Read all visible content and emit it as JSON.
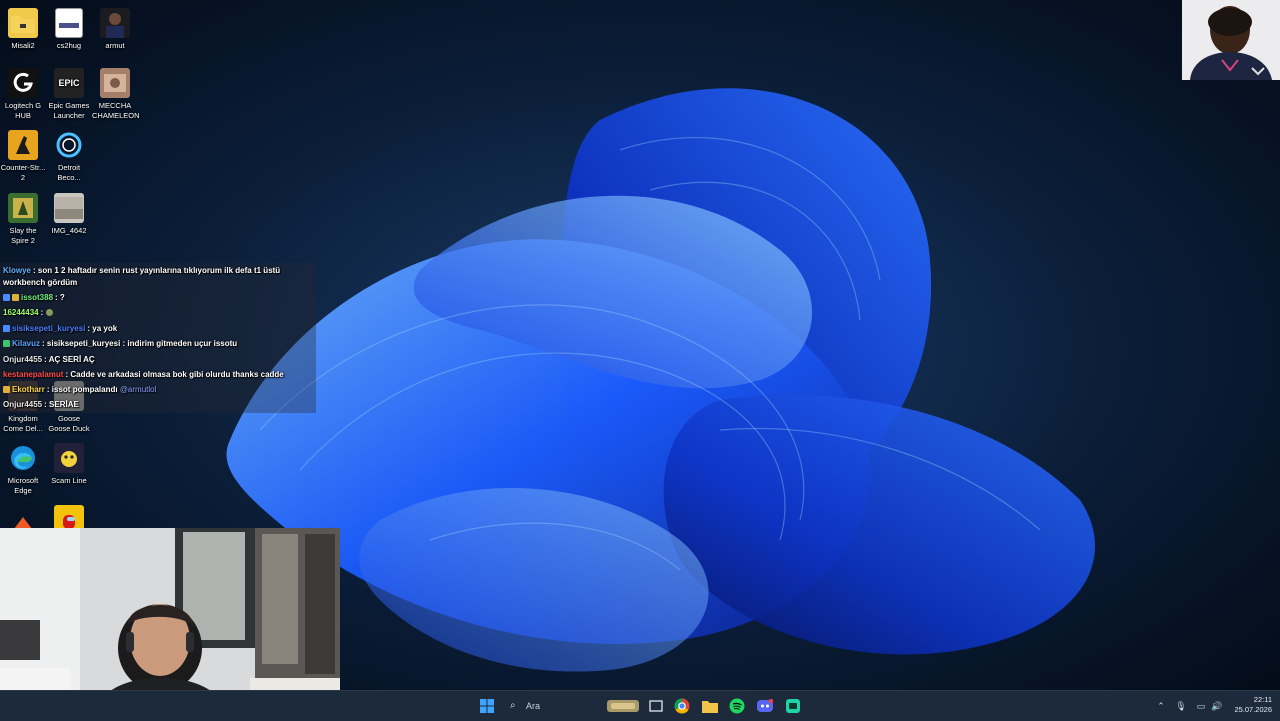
{
  "desktop": {
    "icons": [
      {
        "label": "Misali2",
        "icon": "folder-icon"
      },
      {
        "label": "cs2hug",
        "icon": "image-file-icon"
      },
      {
        "label": "armut",
        "icon": "image-file-icon"
      },
      {
        "label": "Logitech G HUB",
        "icon": "logitech-icon"
      },
      {
        "label": "Epic Games Launcher",
        "icon": "epic-games-icon",
        "glyph_text": "EPIC"
      },
      {
        "label": "MECCHA CHAMELEON",
        "icon": "game-icon"
      },
      {
        "label": "Counter-Str... 2",
        "icon": "counter-strike-icon"
      },
      {
        "label": "Detroit Beco...",
        "icon": "detroit-icon"
      },
      {
        "label": "Slay the Spire 2",
        "icon": "game-icon"
      },
      {
        "label": "IMG_4642",
        "icon": "image-file-icon"
      },
      {
        "label": "Kingdom Come Del...",
        "icon": "game-icon"
      },
      {
        "label": "Goose Goose Duck",
        "icon": "game-icon"
      },
      {
        "label": "Microsoft Edge",
        "icon": "edge-icon"
      },
      {
        "label": "Scam Line",
        "icon": "game-icon"
      }
    ]
  },
  "chat": {
    "messages": [
      {
        "user": "Klowye",
        "text": ": son 1 2 haftadır senin rust yayınlarına tıklıyorum ilk defa t1 üstü workbench gördüm",
        "user_color": "#5fb3ff"
      },
      {
        "user": "issot388",
        "text": ": ?",
        "user_color": "#6cf07a"
      },
      {
        "user": "16244434",
        "text": ":",
        "user_color": "#9dff6a"
      },
      {
        "user": "sisiksepeti_kuryesi",
        "text": ": ya yok",
        "user_color": "#4a7dff"
      },
      {
        "user": "Kilavuz",
        "text": ": sisiksepeti_kuryesi : indirim gitmeden uçur issotu",
        "user_color": "#58a6ff"
      },
      {
        "user": "Onjur4455",
        "text": ": AÇ SERİ AÇ",
        "user_color": "#e6e6e6"
      },
      {
        "user": "kestanepalamut",
        "text": ": Cadde ve arkadasi olmasa bok gibi olurdu thanks cadde",
        "user_color": "#ff4b4b"
      },
      {
        "user": "Ekotharr",
        "text": ": issot pompalandı",
        "mention": "@armutlol",
        "user_color": "#ffd84a"
      },
      {
        "user": "Onjur4455",
        "text": ": SERİAE",
        "user_color": "#e6e6e6"
      }
    ],
    "mention_color": "#8aa2ff"
  },
  "taskbar": {
    "search_placeholder": "Ara",
    "apps": [
      "start-icon",
      "search-icon",
      "task-view-icon",
      "chrome-icon",
      "file-explorer-icon",
      "spotify-icon",
      "discord-icon",
      "app-icon"
    ],
    "clock_time": "22:11",
    "clock_date": "25.07.2026"
  },
  "colors": {
    "accent": "#0a62ff",
    "taskbar_bg": "#1c2a3b",
    "desktop_bg": "#061426"
  }
}
